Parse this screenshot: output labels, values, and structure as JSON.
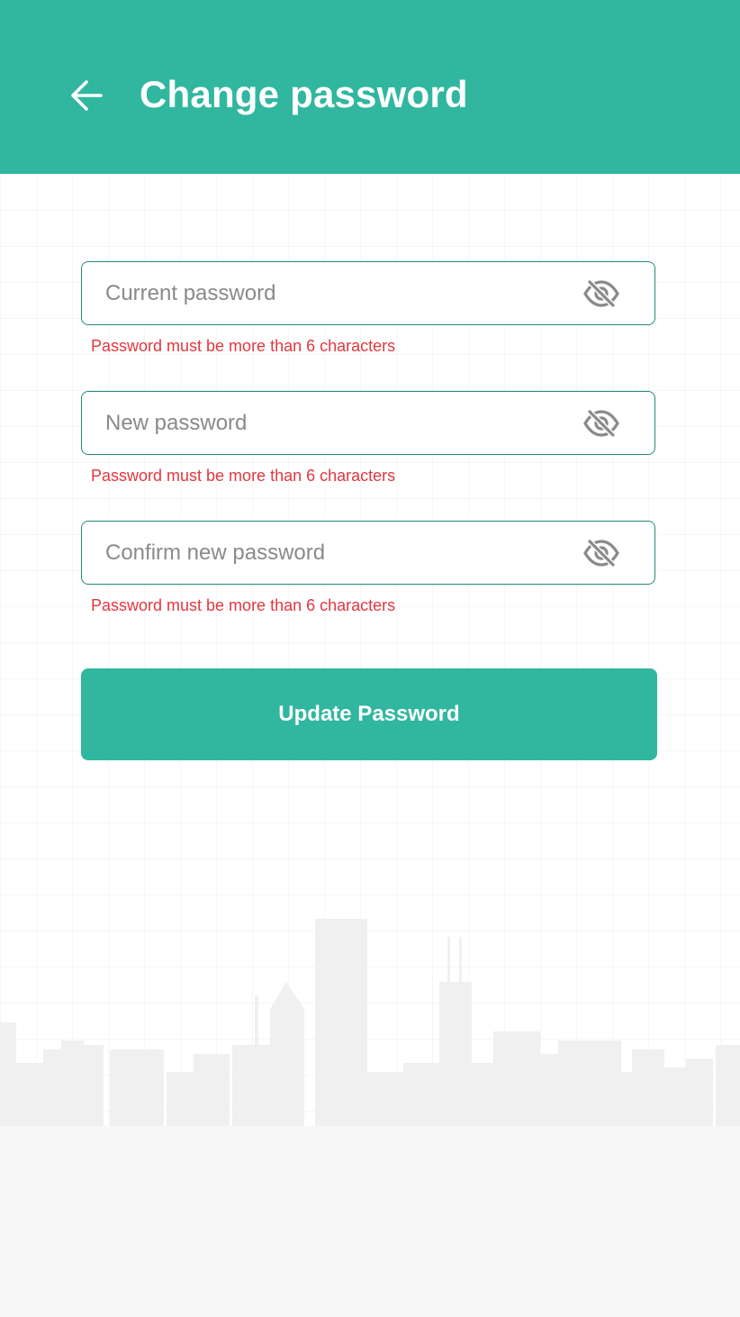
{
  "header": {
    "title": "Change password",
    "back_icon": "arrow-left-icon",
    "background_color": "#31b79f"
  },
  "form": {
    "fields": [
      {
        "placeholder": "Current password",
        "value": "",
        "error": "Password must be more than 6 characters",
        "toggle_icon": "eye-off-icon"
      },
      {
        "placeholder": "New password",
        "value": "",
        "error": "Password must be more than 6 characters",
        "toggle_icon": "eye-off-icon"
      },
      {
        "placeholder": "Confirm new password",
        "value": "",
        "error": "Password must be more than 6 characters",
        "toggle_icon": "eye-off-icon"
      }
    ],
    "submit_label": "Update Password"
  },
  "colors": {
    "accent": "#31b79f",
    "error": "#e2373f",
    "field_border": "#1f8c78"
  }
}
